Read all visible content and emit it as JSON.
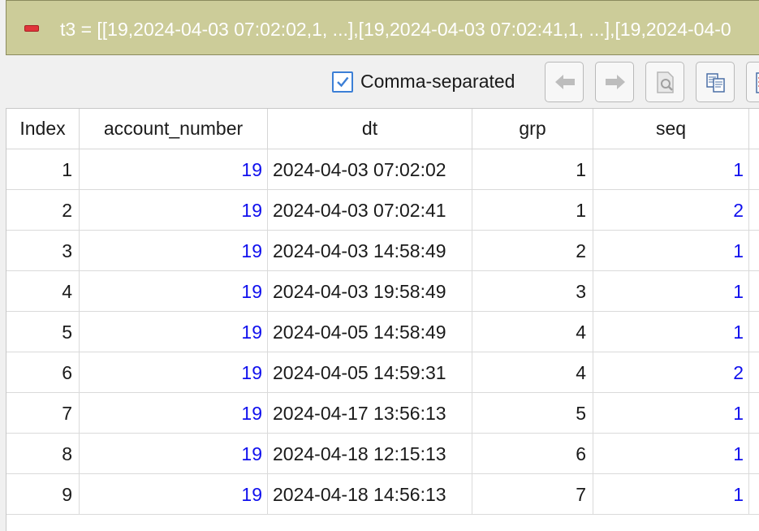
{
  "variable_bar": {
    "title": "t3 = [[19,2024-04-03 07:02:02,1, ...],[19,2024-04-03 07:02:41,1, ...],[19,2024-04-0"
  },
  "toolbar": {
    "comma_separated_label": "Comma-separated",
    "comma_separated_checked": true
  },
  "table": {
    "columns": [
      "Index",
      "account_number",
      "dt",
      "grp",
      "seq"
    ],
    "rows": [
      {
        "index": "1",
        "account_number": "19",
        "dt": "2024-04-03 07:02:02",
        "grp": "1",
        "seq": "1"
      },
      {
        "index": "2",
        "account_number": "19",
        "dt": "2024-04-03 07:02:41",
        "grp": "1",
        "seq": "2"
      },
      {
        "index": "3",
        "account_number": "19",
        "dt": "2024-04-03 14:58:49",
        "grp": "2",
        "seq": "1"
      },
      {
        "index": "4",
        "account_number": "19",
        "dt": "2024-04-03 19:58:49",
        "grp": "3",
        "seq": "1"
      },
      {
        "index": "5",
        "account_number": "19",
        "dt": "2024-04-05 14:58:49",
        "grp": "4",
        "seq": "1"
      },
      {
        "index": "6",
        "account_number": "19",
        "dt": "2024-04-05 14:59:31",
        "grp": "4",
        "seq": "2"
      },
      {
        "index": "7",
        "account_number": "19",
        "dt": "2024-04-17 13:56:13",
        "grp": "5",
        "seq": "1"
      },
      {
        "index": "8",
        "account_number": "19",
        "dt": "2024-04-18 12:15:13",
        "grp": "6",
        "seq": "1"
      },
      {
        "index": "9",
        "account_number": "19",
        "dt": "2024-04-18 14:56:13",
        "grp": "7",
        "seq": "1"
      }
    ]
  },
  "colors": {
    "title_bar_bg": "#cccc99",
    "link_blue": "#1010ee",
    "checkbox_accent": "#3c7fd6"
  }
}
